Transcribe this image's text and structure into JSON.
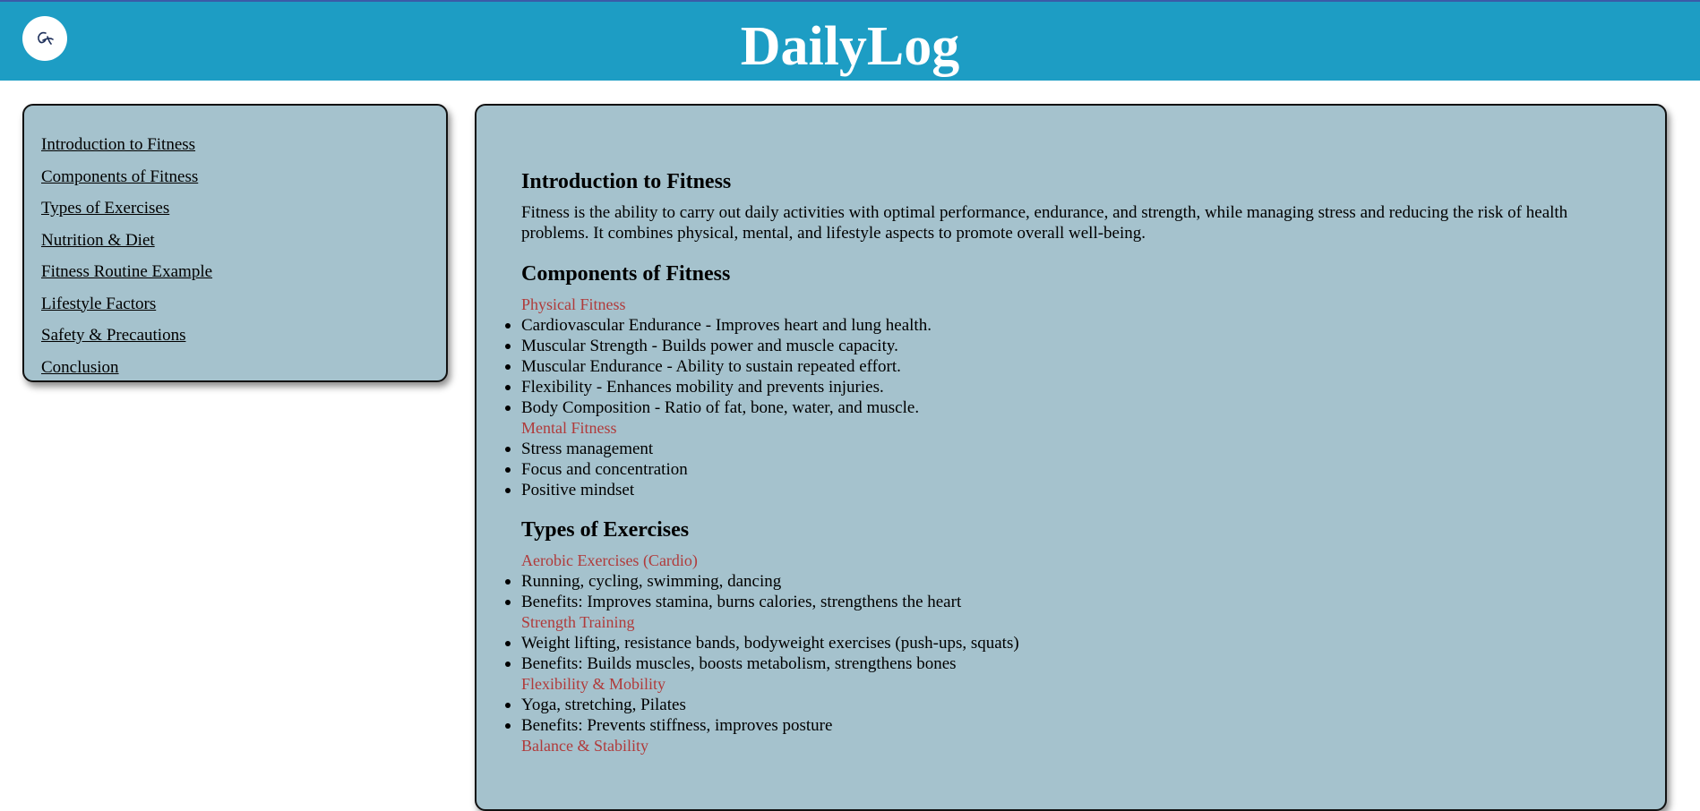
{
  "header": {
    "title": "DailyLog",
    "logo_icon": "signature-logo-icon",
    "background": "#1d9dc4"
  },
  "sidebar": {
    "items": [
      {
        "label": "Introduction to Fitness"
      },
      {
        "label": "Components of Fitness"
      },
      {
        "label": "Types of Exercises"
      },
      {
        "label": "Nutrition & Diet"
      },
      {
        "label": "Fitness Routine Example"
      },
      {
        "label": "Lifestyle Factors"
      },
      {
        "label": "Safety & Precautions"
      },
      {
        "label": "Conclusion"
      }
    ]
  },
  "main": {
    "intro": {
      "title": "Introduction to Fitness",
      "text": "Fitness is the ability to carry out daily activities with optimal performance, endurance, and strength, while managing stress and reducing the risk of health problems. It combines physical, mental, and lifestyle aspects to promote overall well-being."
    },
    "components": {
      "title": "Components of Fitness",
      "groups": [
        {
          "label": "Physical Fitness",
          "items": [
            "Cardiovascular Endurance - Improves heart and lung health.",
            "Muscular Strength - Builds power and muscle capacity.",
            "Muscular Endurance - Ability to sustain repeated effort.",
            "Flexibility - Enhances mobility and prevents injuries.",
            "Body Composition - Ratio of fat, bone, water, and muscle."
          ]
        },
        {
          "label": "Mental Fitness",
          "items": [
            "Stress management",
            "Focus and concentration",
            "Positive mindset"
          ]
        }
      ]
    },
    "exercises": {
      "title": "Types of Exercises",
      "groups": [
        {
          "label": "Aerobic Exercises (Cardio)",
          "items": [
            "Running, cycling, swimming, dancing",
            "Benefits: Improves stamina, burns calories, strengthens the heart"
          ]
        },
        {
          "label": "Strength Training",
          "items": [
            "Weight lifting, resistance bands, bodyweight exercises (push-ups, squats)",
            "Benefits: Builds muscles, boosts metabolism, strengthens bones"
          ]
        },
        {
          "label": "Flexibility & Mobility",
          "items": [
            "Yoga, stretching, Pilates",
            "Benefits: Prevents stiffness, improves posture"
          ]
        },
        {
          "label": "Balance & Stability",
          "items": []
        }
      ]
    }
  }
}
